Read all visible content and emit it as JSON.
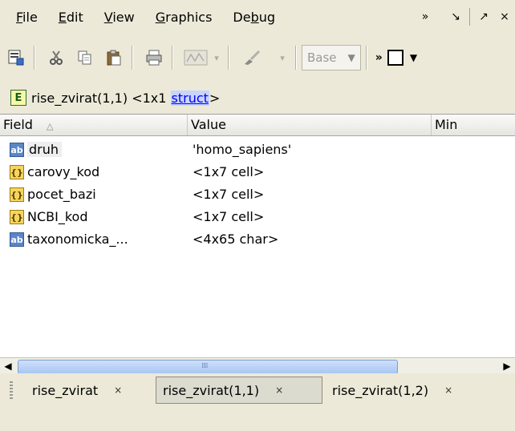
{
  "menubar": {
    "items": [
      "File",
      "Edit",
      "View",
      "Graphics",
      "Debug"
    ],
    "controls": [
      "»",
      "↘",
      "↗",
      "×"
    ]
  },
  "toolbar": {
    "base_combo": "Base",
    "overflow": "»"
  },
  "breadcrumb": {
    "prefix": "rise_zvirat(1,1) <1x1 ",
    "link": "struct",
    "suffix": ">"
  },
  "table": {
    "headers": [
      "Field",
      "Value",
      "Min"
    ],
    "sort_indicator": "△",
    "rows": [
      {
        "icon": "ab",
        "field": "druh",
        "value": "'homo_sapiens'"
      },
      {
        "icon": "cell",
        "field": "carovy_kod",
        "value": "<1x7 cell>"
      },
      {
        "icon": "cell",
        "field": "pocet_bazi",
        "value": "<1x7 cell>"
      },
      {
        "icon": "cell",
        "field": "NCBI_kod",
        "value": "<1x7 cell>"
      },
      {
        "icon": "ab",
        "field": "taxonomicka_...",
        "value": "<4x65 char>"
      }
    ]
  },
  "tabs": [
    {
      "label": "rise_zvirat",
      "close": "×"
    },
    {
      "label": "rise_zvirat(1,1)",
      "close": "×"
    },
    {
      "label": "rise_zvirat(1,2)",
      "close": "×"
    }
  ]
}
